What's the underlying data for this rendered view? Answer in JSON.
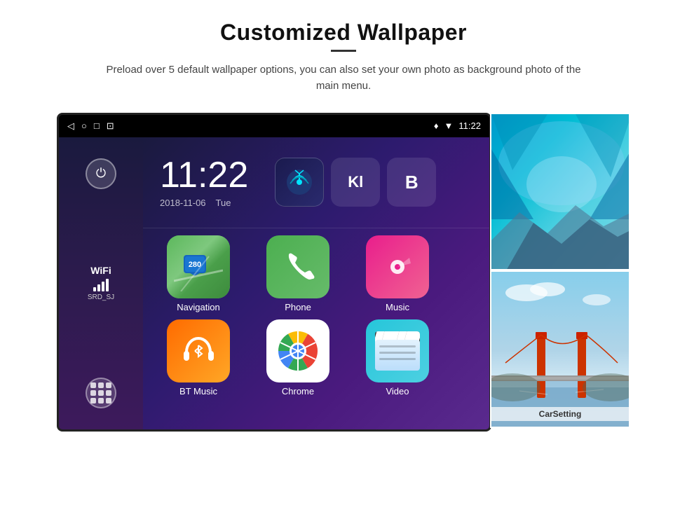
{
  "page": {
    "title": "Customized Wallpaper",
    "divider": "—",
    "subtitle": "Preload over 5 default wallpaper options, you can also set your own photo as background photo of the main menu."
  },
  "device": {
    "status_bar": {
      "back_icon": "◁",
      "home_icon": "○",
      "recent_icon": "□",
      "screenshot_icon": "⊡",
      "location_icon": "♦",
      "wifi_icon": "▼",
      "time": "11:22"
    },
    "clock": {
      "time": "11:22",
      "date": "2018-11-06",
      "day": "Tue"
    },
    "sidebar": {
      "wifi_label": "WiFi",
      "ssid": "SRD_SJ"
    },
    "apps": [
      {
        "label": "Navigation",
        "icon": "navigation"
      },
      {
        "label": "Phone",
        "icon": "phone"
      },
      {
        "label": "Music",
        "icon": "music"
      },
      {
        "label": "BT Music",
        "icon": "bluetooth"
      },
      {
        "label": "Chrome",
        "icon": "chrome"
      },
      {
        "label": "Video",
        "icon": "video"
      }
    ],
    "wallpapers": [
      {
        "label": "ice-cave",
        "alt": "Ice cave wallpaper"
      },
      {
        "label": "CarSetting",
        "alt": "Bridge wallpaper"
      }
    ]
  }
}
